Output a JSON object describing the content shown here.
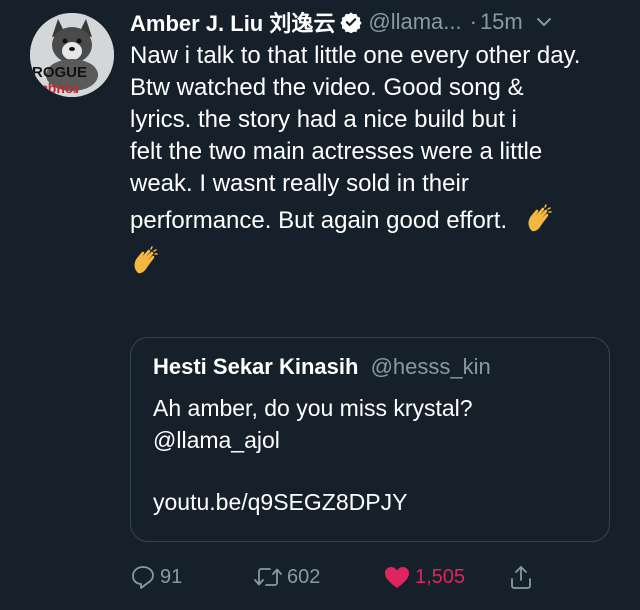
{
  "tweet": {
    "author": {
      "display_name": "Amber J. Liu 刘逸云",
      "handle": "@llama...",
      "verified": true,
      "avatar_text_top": "ROGUE",
      "avatar_text_bottom": "ɐbnoɹ"
    },
    "separator": "·",
    "time": "15m",
    "icons": [
      "verified-badge-icon",
      "chevron-down-icon",
      "clapping-hands-emoji",
      "reply-icon",
      "retweet-icon",
      "heart-icon",
      "share-icon"
    ],
    "body": {
      "paragraph_1": "Naw i talk to that little one every other day.",
      "paragraph_2_lines": [
        "Btw watched the video. Good song &",
        "lyrics. the story had a nice build but i",
        "felt the two main actresses were a little",
        "weak. I wasnt really sold in their"
      ],
      "paragraph_2_last": "performance. But again good effort."
    },
    "quoted": {
      "display_name": "Hesti Sekar Kinasih",
      "handle": "@hesss_kin",
      "text_line_1": "Ah amber, do you miss krystal?",
      "text_line_2": "@llama_ajol",
      "link": "youtu.be/q9SEGZ8DPJY"
    },
    "actions": {
      "replies": "91",
      "retweets": "602",
      "likes": "1,505",
      "liked": true
    },
    "colors": {
      "background": "#15202b",
      "secondary_text": "#8899a6",
      "like": "#e0245e",
      "border": "#38444d"
    }
  }
}
